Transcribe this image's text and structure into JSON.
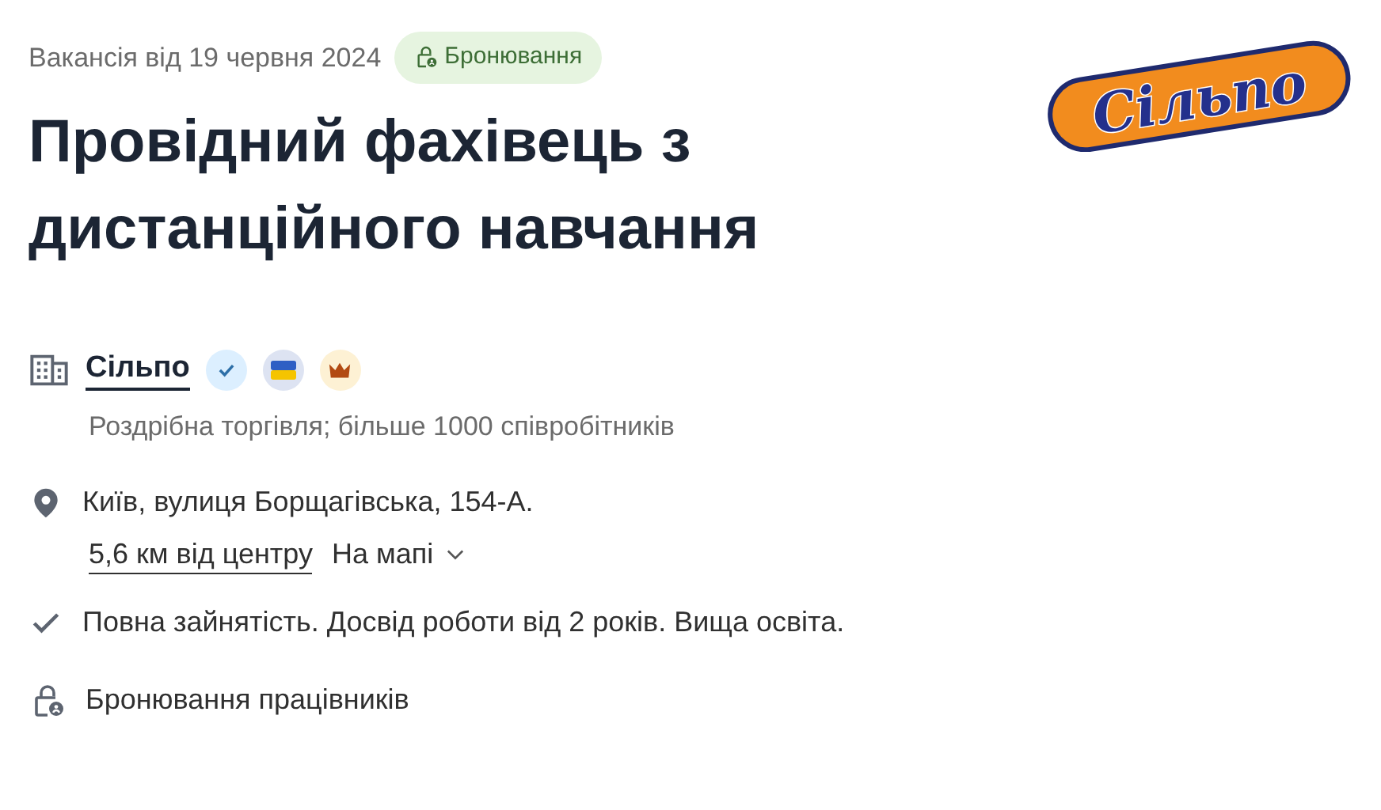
{
  "posted": "Вакансія від 19 червня 2024",
  "badge": {
    "label": "Бронювання"
  },
  "logo": {
    "text": "Сільпо"
  },
  "title": "Провідний фахівець з дистанційного навчання",
  "company": {
    "name": "Сільпо",
    "verified": true,
    "ukrainian": true,
    "top": true,
    "description": "Роздрібна торгівля; більше 1000 співробітників"
  },
  "location": {
    "address": "Київ, вулиця Борщагівська, 154-А.",
    "distance": "5,6 км від центру",
    "map_link": "На мапі"
  },
  "conditions": "Повна зайнятість. Досвід роботи від 2 років. Вища освіта.",
  "reservation": "Бронювання працівників"
}
